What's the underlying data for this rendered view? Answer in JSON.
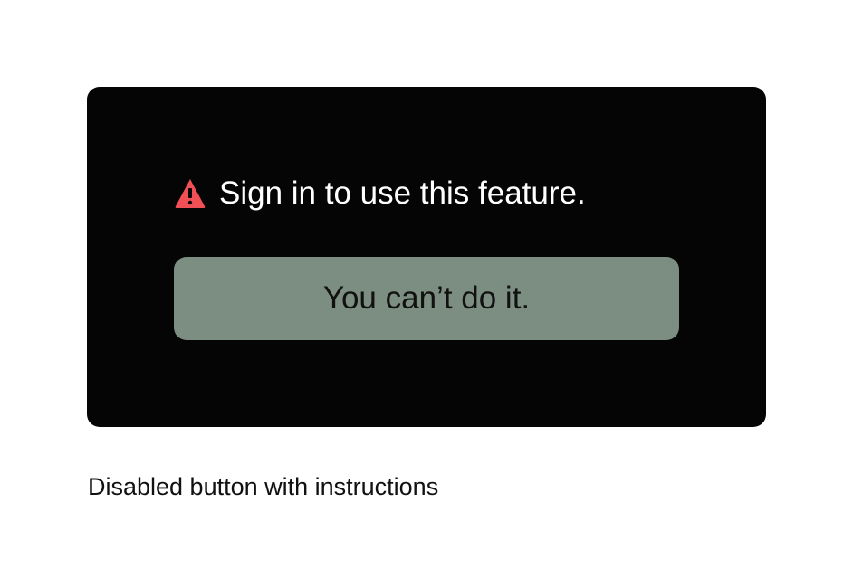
{
  "card": {
    "message": "Sign in to use this feature.",
    "warning_icon": "warning-triangle-icon",
    "button_label": "You can’t do it.",
    "button_state": "disabled"
  },
  "caption": "Disabled button with instructions",
  "colors": {
    "card_background": "#050505",
    "warning": "#f04f55",
    "button_background": "#7b8e81",
    "message_text": "#ffffff",
    "button_text": "#111111"
  }
}
